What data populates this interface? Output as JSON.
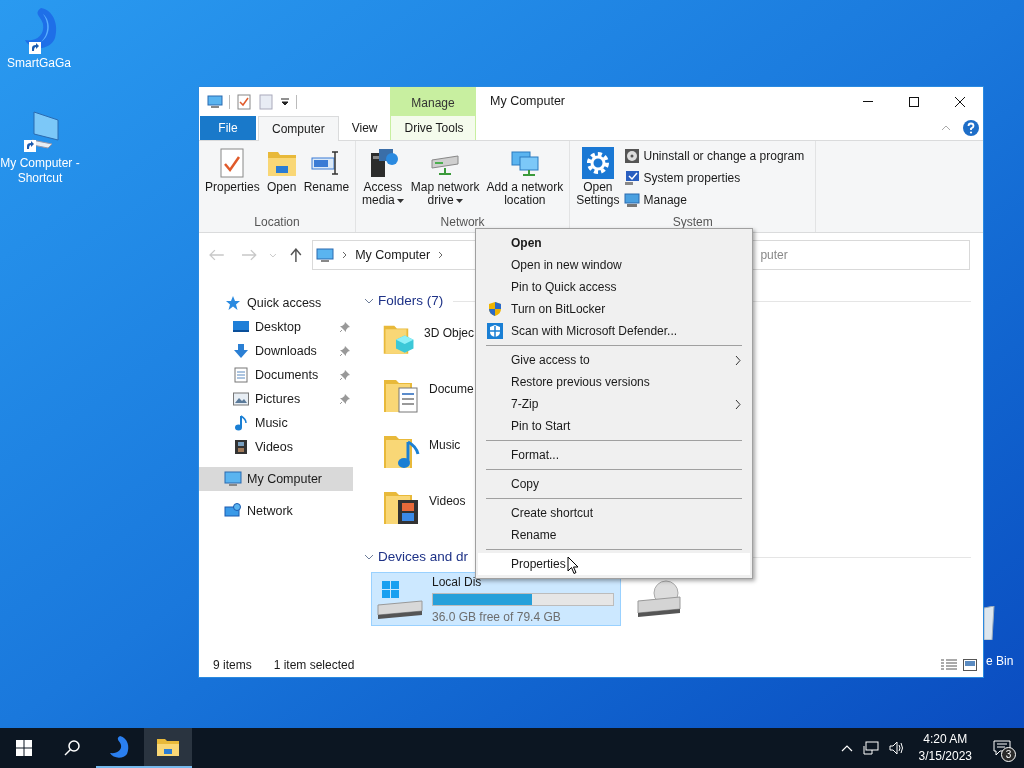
{
  "desktop_icons": [
    {
      "label": "SmartGaGa"
    },
    {
      "label": "My Computer - Shortcut"
    }
  ],
  "recycle_bin": {
    "label": "e Bin"
  },
  "window": {
    "context_tab": "Manage",
    "title": "My Computer",
    "tabs": [
      {
        "label": "File",
        "kind": "file",
        "selected": false
      },
      {
        "label": "Computer",
        "kind": "normal",
        "selected": true
      },
      {
        "label": "View",
        "kind": "normal",
        "selected": false
      },
      {
        "label": "Drive Tools",
        "kind": "context",
        "selected": false
      }
    ],
    "ribbon_groups": [
      {
        "label": "Location",
        "buttons": [
          {
            "kind": "large",
            "lines": [
              "Properties"
            ],
            "dropdown": false
          },
          {
            "kind": "large",
            "lines": [
              "Open"
            ],
            "dropdown": false
          },
          {
            "kind": "large",
            "lines": [
              "Rename"
            ],
            "dropdown": false
          }
        ]
      },
      {
        "label": "Network",
        "buttons": [
          {
            "kind": "large",
            "lines": [
              "Access",
              "media"
            ],
            "dropdown": true
          },
          {
            "kind": "large",
            "lines": [
              "Map network",
              "drive"
            ],
            "dropdown": true
          },
          {
            "kind": "large",
            "lines": [
              "Add a network",
              "location"
            ],
            "dropdown": false
          }
        ]
      },
      {
        "label": "System",
        "buttons": [
          {
            "kind": "large",
            "lines": [
              "Open",
              "Settings"
            ],
            "dropdown": false
          },
          {
            "kind": "small",
            "lines": [
              "Uninstall or change a program"
            ],
            "dropdown": false
          },
          {
            "kind": "small",
            "lines": [
              "System properties"
            ],
            "dropdown": false
          },
          {
            "kind": "small",
            "lines": [
              "Manage"
            ],
            "dropdown": false
          }
        ]
      }
    ],
    "address": {
      "path": "My Computer"
    },
    "search": {
      "placeholder": "puter"
    },
    "nav": [
      {
        "label": "Quick access",
        "selected": false,
        "pinned": false,
        "children": [
          {
            "label": "Desktop",
            "selected": false,
            "pinned": true
          },
          {
            "label": "Downloads",
            "selected": false,
            "pinned": true
          },
          {
            "label": "Documents",
            "selected": false,
            "pinned": true
          },
          {
            "label": "Pictures",
            "selected": false,
            "pinned": true
          },
          {
            "label": "Music",
            "selected": false,
            "pinned": false
          },
          {
            "label": "Videos",
            "selected": false,
            "pinned": false
          }
        ]
      },
      {
        "label": "My Computer",
        "selected": true,
        "pinned": false
      },
      {
        "label": "Network",
        "selected": false,
        "pinned": false
      }
    ],
    "sections": [
      {
        "title": "Folders (7)",
        "expanded": true,
        "kind": "folders",
        "items": [
          {
            "label": "3D Objec"
          },
          {
            "label": "Docume"
          },
          {
            "label": "Music"
          },
          {
            "label": "Videos"
          }
        ]
      },
      {
        "title": "Devices and dr",
        "expanded": true,
        "kind": "drives",
        "items": [
          {
            "kind": "disk",
            "label": "Local Dis",
            "free": "36.0 GB free of 79.4 GB",
            "level": 0.55,
            "selected": true
          },
          {
            "kind": "cd",
            "selected": false
          }
        ]
      }
    ],
    "status": {
      "count": "9 items",
      "selection": "1 item selected"
    }
  },
  "context_menu": {
    "items": [
      {
        "kind": "item",
        "label": "Open",
        "bold": true,
        "submenu": false,
        "selected": false
      },
      {
        "kind": "item",
        "label": "Open in new window",
        "bold": false,
        "submenu": false,
        "selected": false
      },
      {
        "kind": "item",
        "label": "Pin to Quick access",
        "bold": false,
        "submenu": false,
        "selected": false
      },
      {
        "kind": "item",
        "label": "Turn on BitLocker",
        "bold": false,
        "submenu": false,
        "selected": false
      },
      {
        "kind": "item",
        "label": "Scan with Microsoft Defender...",
        "bold": false,
        "submenu": false,
        "selected": false
      },
      {
        "kind": "separator"
      },
      {
        "kind": "item",
        "label": "Give access to",
        "bold": false,
        "submenu": true,
        "selected": false
      },
      {
        "kind": "item",
        "label": "Restore previous versions",
        "bold": false,
        "submenu": false,
        "selected": false
      },
      {
        "kind": "item",
        "label": "7-Zip",
        "bold": false,
        "submenu": true,
        "selected": false
      },
      {
        "kind": "item",
        "label": "Pin to Start",
        "bold": false,
        "submenu": false,
        "selected": false
      },
      {
        "kind": "separator"
      },
      {
        "kind": "item",
        "label": "Format...",
        "bold": false,
        "submenu": false,
        "selected": false
      },
      {
        "kind": "separator"
      },
      {
        "kind": "item",
        "label": "Copy",
        "bold": false,
        "submenu": false,
        "selected": false
      },
      {
        "kind": "separator"
      },
      {
        "kind": "item",
        "label": "Create shortcut",
        "bold": false,
        "submenu": false,
        "selected": false
      },
      {
        "kind": "item",
        "label": "Rename",
        "bold": false,
        "submenu": false,
        "selected": false
      },
      {
        "kind": "separator"
      },
      {
        "kind": "item",
        "label": "Properties",
        "bold": false,
        "submenu": false,
        "selected": true
      }
    ]
  },
  "taskbar": {
    "apps": [
      {
        "selected": false
      },
      {
        "selected": true
      }
    ],
    "time": "4:20 AM",
    "date": "3/15/2023",
    "notifications": "3"
  }
}
